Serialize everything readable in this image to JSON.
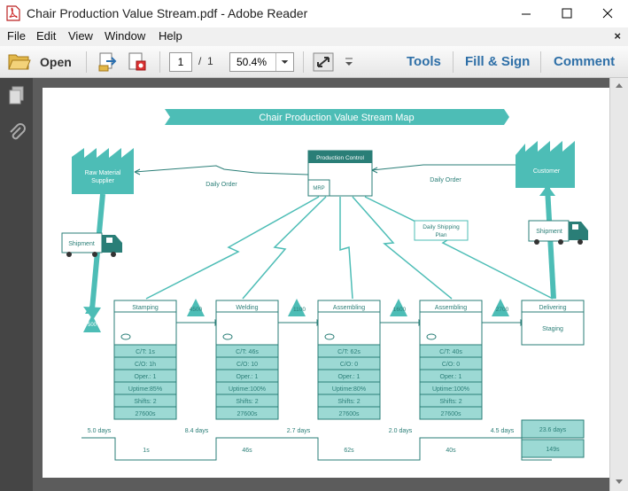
{
  "window": {
    "title": "Chair Production Value Stream.pdf - Adobe Reader"
  },
  "menu": {
    "items": [
      "File",
      "Edit",
      "View",
      "Window",
      "Help"
    ],
    "close": "×"
  },
  "toolbar": {
    "open": "Open",
    "page_current": "1",
    "page_sep": "/",
    "page_total": "1",
    "zoom": "50.4%",
    "tools": "Tools",
    "fill_sign": "Fill & Sign",
    "comment": "Comment"
  },
  "colors": {
    "teal": "#4dbdb6",
    "teal_light": "#9cd9d4",
    "line": "#2a7e77",
    "brand_link": "#2e6fa7"
  },
  "vsm": {
    "title": "Chair Production Value Stream Map",
    "supplier": [
      "Raw Material",
      "Supplier"
    ],
    "customer": "Customer",
    "production_control": "Production Control",
    "mrp": "MRP",
    "daily_order_left": "Daily Order",
    "daily_order_right": "Daily Order",
    "daily_shipping": [
      "Daily Shipping",
      "Plan"
    ],
    "shipment_left": "Shipment",
    "shipment_right": "Shipment",
    "inv_supplier": "500",
    "inventories": [
      "4500",
      "1100",
      "1600",
      "2700"
    ],
    "processes": [
      {
        "name": "Stamping",
        "data": [
          "C/T: 1s",
          "C/O: 1h",
          "Oper.: 1",
          "Uptime:85%",
          "Shifts: 2",
          "27600s"
        ]
      },
      {
        "name": "Welding",
        "data": [
          "C/T: 46s",
          "C/O: 10",
          "Oper.: 1",
          "Uptime:100%",
          "Shifts: 2",
          "27600s"
        ]
      },
      {
        "name": "Assembling",
        "data": [
          "C/T: 62s",
          "C/O: 0",
          "Oper.: 1",
          "Uptime:80%",
          "Shifts: 2",
          "27600s"
        ]
      },
      {
        "name": "Assembling",
        "data": [
          "C/T: 40s",
          "C/O: 0",
          "Oper.: 1",
          "Uptime:100%",
          "Shifts: 2",
          "27600s"
        ]
      }
    ],
    "delivering": {
      "name": "Delivering",
      "sub": "Staging"
    },
    "timeline_days": [
      "5.0 days",
      "8.4 days",
      "2.7 days",
      "2.0 days",
      "4.5 days"
    ],
    "timeline_secs": [
      "1s",
      "46s",
      "62s",
      "40s"
    ],
    "total_days": "23.6 days",
    "total_secs": "149s"
  }
}
